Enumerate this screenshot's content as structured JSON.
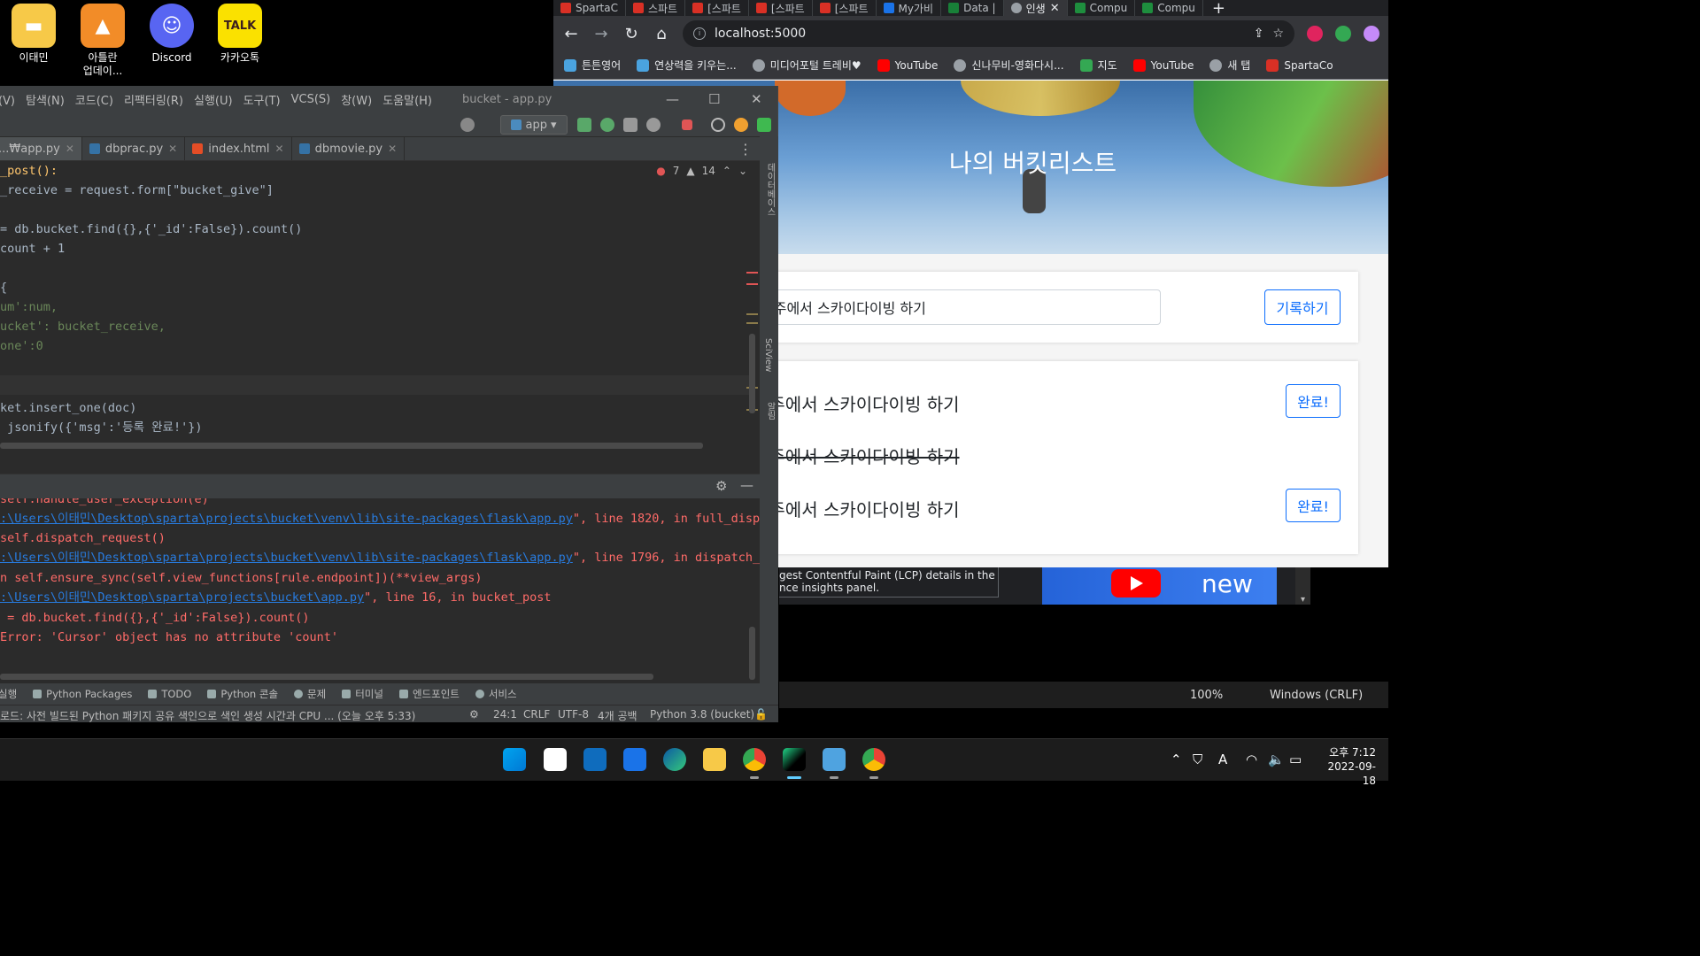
{
  "desktop": {
    "icons": [
      {
        "label": "이태민",
        "color": "#f7c948"
      },
      {
        "label": "아틀란\n업데이...",
        "color": "#f28c28"
      },
      {
        "label": "Discord",
        "color": "#5865f2"
      },
      {
        "label": "카카오톡",
        "color": "#fae100",
        "glyph": "TALK"
      }
    ]
  },
  "browser": {
    "tabs": [
      {
        "label": "SpartaC",
        "color": "#d93025"
      },
      {
        "label": "스파트",
        "color": "#d93025"
      },
      {
        "label": "[스파트",
        "color": "#d93025"
      },
      {
        "label": "[스파트",
        "color": "#d93025"
      },
      {
        "label": "[스파트",
        "color": "#d93025"
      },
      {
        "label": "My가비",
        "color": "#1a73e8"
      },
      {
        "label": "Data |",
        "color": "#188038"
      },
      {
        "label": "인생",
        "color": "#9aa0a6",
        "active": true
      },
      {
        "label": "Compu",
        "color": "#1e8e3e"
      },
      {
        "label": "Compu",
        "color": "#1e8e3e"
      }
    ],
    "url": "localhost:5000",
    "bookmarks": [
      {
        "label": "튼튼영어",
        "color": "#4aa3df"
      },
      {
        "label": "연상력을 키우는...",
        "color": "#4aa3df"
      },
      {
        "label": "미디어포털 트레비♥",
        "color": "#9aa0a6"
      },
      {
        "label": "YouTube",
        "color": "#ff0000"
      },
      {
        "label": "신나무비-영화다시...",
        "color": "#9aa0a6"
      },
      {
        "label": "지도",
        "color": "#34a853"
      },
      {
        "label": "YouTube",
        "color": "#ff0000"
      },
      {
        "label": "새 탭",
        "color": "#9aa0a6"
      },
      {
        "label": "SpartaCo",
        "color": "#d93025"
      }
    ],
    "page": {
      "title": "나의 버킷리스트",
      "input_value": "호주에서 스카이다이빙 하기",
      "submit_label": "기록하기",
      "items": [
        {
          "text": "호주에서 스카이다이빙 하기",
          "done": false,
          "button": "완료!"
        },
        {
          "text": "호주에서 스카이다이빙 하기",
          "done": true
        },
        {
          "text": "호주에서 스카이다이빙 하기",
          "done": false,
          "button": "완료!"
        }
      ]
    },
    "devtools": {
      "line1": "gest Contentful Paint (LCP) details in the",
      "line2": "nce insights panel.",
      "thumb_text": "new"
    },
    "status": {
      "zoom": "100%",
      "line_ending": "Windows (CRLF)"
    }
  },
  "ide": {
    "menu": [
      "뷰(V)",
      "탐색(N)",
      "코드(C)",
      "리팩터링(R)",
      "실행(U)",
      "도구(T)",
      "VCS(S)",
      "창(W)",
      "도움말(H)"
    ],
    "title": "bucket - app.py",
    "run_config": "app",
    "tabs": [
      {
        "label": "...₩app.py",
        "active": true
      },
      {
        "label": "dbprac.py"
      },
      {
        "label": "index.html"
      },
      {
        "label": "dbmovie.py"
      }
    ],
    "inspections": {
      "errors": "7",
      "warnings": "14"
    },
    "code": [
      "_post():",
      "_receive = request.form[\"bucket_give\"]",
      "",
      "= db.bucket.find({},{'_id':False}).count()",
      "count + 1",
      "",
      "{",
      "um':num,",
      "ucket': bucket_receive,",
      "one':0",
      "",
      "",
      "ket.insert_one(doc)",
      " jsonify({'msg':'등록 완료!'})"
    ],
    "console": [
      {
        "text": "self.handle_user_exception(e)"
      },
      {
        "link": ":\\Users\\이태민\\Desktop\\sparta\\projects\\bucket\\venv\\lib\\site-packages\\flask\\app.py",
        "rest": "\", line 1820, in full_disp"
      },
      {
        "text": "self.dispatch_request()"
      },
      {
        "link": ":\\Users\\이태민\\Desktop\\sparta\\projects\\bucket\\venv\\lib\\site-packages\\flask\\app.py",
        "rest": "\", line 1796, in dispatch_"
      },
      {
        "text": "n self.ensure_sync(self.view_functions[rule.endpoint])(**view_args)"
      },
      {
        "link": ":\\Users\\이태민\\Desktop\\sparta\\projects\\bucket\\app.py",
        "rest": "\", line 16, in bucket_post"
      },
      {
        "text": " = db.bucket.find({},{'_id':False}).count()"
      },
      {
        "text": "Error: 'Cursor' object has no attribute 'count'"
      }
    ],
    "tool_tabs": [
      "실행",
      "Python Packages",
      "TODO",
      "Python 콘솔",
      "문제",
      "터미널",
      "엔드포인트",
      "서비스"
    ],
    "right_strip": [
      "데이터베이스",
      "SciView",
      "알림"
    ],
    "status": {
      "message": "로드: 사전 빌드된 Python 패키지 공유 색인으로 색인 생성 시간과 CPU ... (오늘 오후 5:33)",
      "position": "24:1",
      "line_sep": "CRLF",
      "encoding": "UTF-8",
      "indent": "4개 공백",
      "interpreter": "Python 3.8 (bucket)"
    }
  },
  "taskbar": {
    "time": "오후 7:12",
    "date": "2022-09-18",
    "ime": "A"
  }
}
